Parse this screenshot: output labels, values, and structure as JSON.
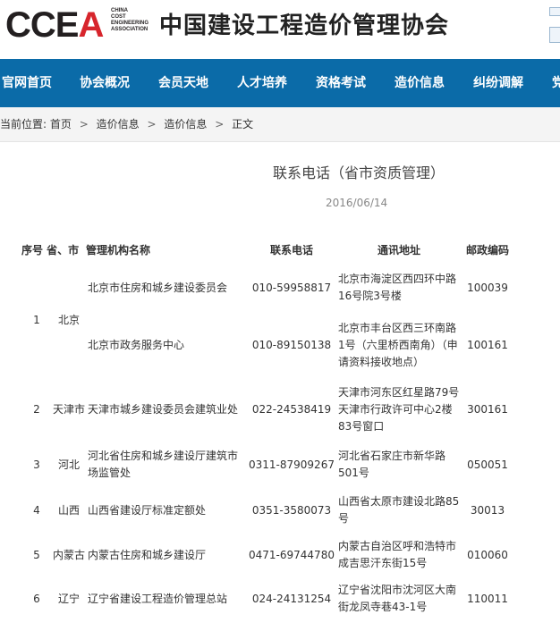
{
  "header": {
    "logo_main": "CCE",
    "logo_accent": "A",
    "logo_small": [
      "CHINA",
      "COST",
      "ENGINEERING",
      "ASSOCIATION"
    ],
    "site_title": "中国建设工程造价管理协会"
  },
  "nav": {
    "items": [
      "官网首页",
      "协会概况",
      "会员天地",
      "人才培养",
      "资格考试",
      "造价信息",
      "纠纷调解",
      "党"
    ]
  },
  "breadcrumb": {
    "prefix": "当前位置:",
    "items": [
      "首页",
      "造价信息",
      "造价信息",
      "正文"
    ],
    "separator": ">"
  },
  "article": {
    "title": "联系电话（省市资质管理）",
    "date": "2016/06/14"
  },
  "table": {
    "headers": {
      "no_province": "序号 省、市",
      "org": "管理机构名称",
      "phone": "联系电话",
      "address": "通讯地址",
      "zip": "邮政编码"
    },
    "rows": [
      {
        "no": "1",
        "province": "北京",
        "org": "北京市住房和城乡建设委员会",
        "phone": "010-59958817",
        "address": "北京市海淀区西四环中路16号院3号楼",
        "zip": "100039"
      },
      {
        "no": "",
        "province": "",
        "org": "北京市政务服务中心",
        "phone": "010-89150138",
        "address": "北京市丰台区西三环南路1号（六里桥西南角）（申请资料接收地点）",
        "zip": "100161"
      },
      {
        "no": "2",
        "province": "天津市",
        "org": "天津市城乡建设委员会建筑业处",
        "phone": "022-24538419",
        "address": "天津市河东区红星路79号天津市行政许可中心2楼83号窗口",
        "zip": "300161"
      },
      {
        "no": "3",
        "province": "河北",
        "org": "河北省住房和城乡建设厅建筑市场监管处",
        "phone": "0311-87909267",
        "address": "河北省石家庄市新华路501号",
        "zip": "050051"
      },
      {
        "no": "4",
        "province": "山西",
        "org": "山西省建设厅标准定额处",
        "phone": "0351-3580073",
        "address": "山西省太原市建设北路85号",
        "zip": "30013"
      },
      {
        "no": "5",
        "province": "内蒙古",
        "org": "内蒙古住房和城乡建设厅",
        "phone": "0471-69744780",
        "address": "内蒙古自治区呼和浩特市成吉思汗东街15号",
        "zip": "010060"
      },
      {
        "no": "6",
        "province": "辽宁",
        "org": "辽宁省建设工程造价管理总站",
        "phone": "024-24131254",
        "address": "辽宁省沈阳市沈河区大南街龙凤寺巷43-1号",
        "zip": "110011"
      }
    ]
  }
}
